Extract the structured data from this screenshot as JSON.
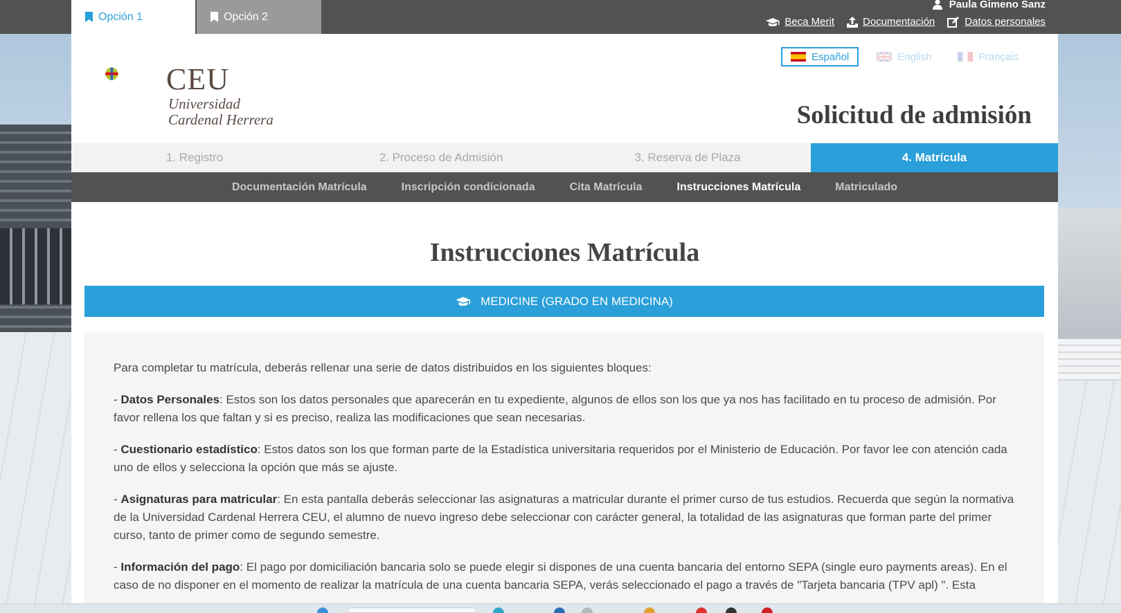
{
  "tabs": [
    {
      "label": "Opción 1",
      "active": true
    },
    {
      "label": "Opción 2",
      "active": false
    }
  ],
  "user": {
    "name": "Paula Gimeno Sanz",
    "links": [
      {
        "label": "Beca Merit",
        "icon": "graduation-cap-icon"
      },
      {
        "label": "Documentación",
        "icon": "upload-icon"
      },
      {
        "label": "Datos personales",
        "icon": "edit-icon"
      }
    ]
  },
  "logo": {
    "ceu": "CEU",
    "line1": "Universidad",
    "line2": "Cardenal Herrera"
  },
  "languages": [
    {
      "label": "Español",
      "active": true
    },
    {
      "label": "English",
      "active": false
    },
    {
      "label": "Français",
      "active": false
    }
  ],
  "page_title": "Solicitud de admisión",
  "steps": [
    {
      "label": "1. Registro"
    },
    {
      "label": "2. Proceso de Admisión"
    },
    {
      "label": "3. Reserva de Plaza"
    },
    {
      "label": "4. Matrícula",
      "active": true
    }
  ],
  "subnav": [
    {
      "label": "Documentación Matrícula"
    },
    {
      "label": "Inscripción condicionada"
    },
    {
      "label": "Cita Matrícula"
    },
    {
      "label": "Instrucciones Matrícula",
      "active": true
    },
    {
      "label": "Matriculado"
    }
  ],
  "content": {
    "title": "Instrucciones Matrícula",
    "degree": "MEDICINE (GRADO EN MEDICINA)",
    "intro": "Para completar tu matrícula, deberás rellenar una serie de datos distribuidos en los siguientes bloques:",
    "blocks": [
      {
        "prefix": "- ",
        "bold": "Datos Personales",
        "text": ": Estos son los datos personales que aparecerán en tu expediente, algunos de ellos son los que ya nos has facilitado en tu proceso de admisión. Por favor rellena los que faltan y si es preciso, realiza las modificaciones que sean necesarias."
      },
      {
        "prefix": "- ",
        "bold": "Cuestionario estadístico",
        "text": ": Estos datos son los que forman parte de la Estadística universitaria requeridos por el Ministerio de Educación. Por favor lee con atención cada uno de ellos y selecciona la opción que más se ajuste."
      },
      {
        "prefix": "- ",
        "bold": "Asignaturas para matricular",
        "text": ": En esta pantalla deberás seleccionar las asignaturas a matricular durante el primer curso de tus estudios. Recuerda que según la normativa de la Universidad Cardenal Herrera CEU, el alumno de nuevo ingreso debe seleccionar con carácter general, la totalidad de las asignaturas que forman parte del primer curso, tanto de primer como de segundo semestre."
      },
      {
        "prefix": "- ",
        "bold": "Información del pago",
        "text": ": El pago por domiciliación bancaria solo se puede elegir si dispones de una cuenta bancaria del entorno SEPA (single euro payments areas). En el caso de no disponer en el momento de realizar la matrícula de una cuenta bancaria SEPA, verás seleccionado el pago a través de \"Tarjeta bancaria (TPV apl) \". Esta"
      }
    ]
  },
  "colors": {
    "accent": "#2a9fd9",
    "dark_bar": "#525252",
    "text": "#4a4a4a"
  }
}
